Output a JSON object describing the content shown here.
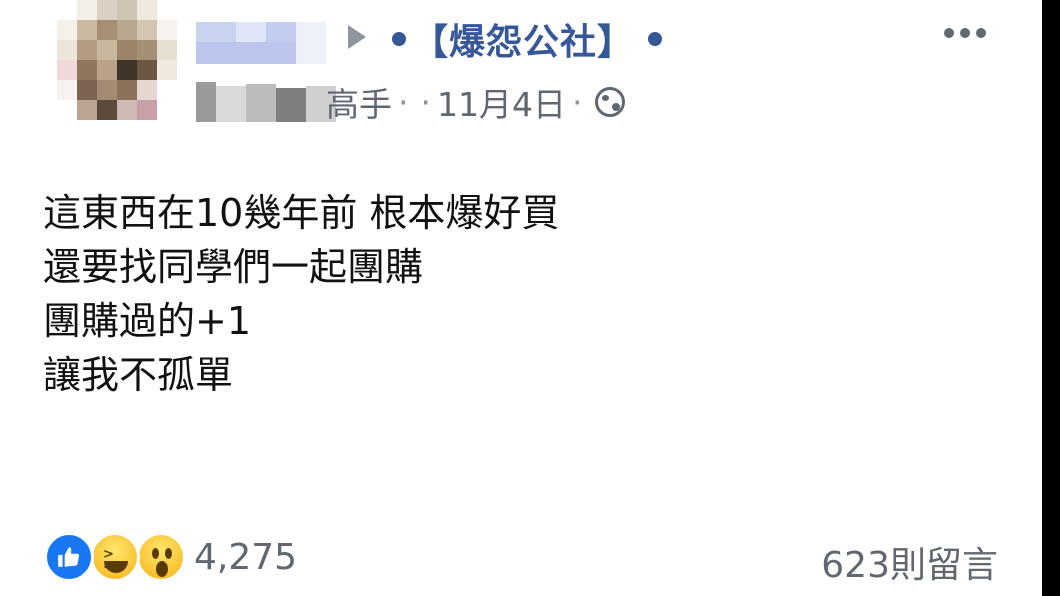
{
  "post": {
    "group_name": "【爆怨公社】",
    "author_title_fragment": "高手",
    "separator": "·",
    "date": "11月4日",
    "body_lines": [
      "這東西在10幾年前 根本爆好買",
      "還要找同學們一起團購",
      "團購過的+1",
      "讓我不孤單"
    ]
  },
  "reactions": {
    "count": "4,275",
    "icons": [
      "like-icon",
      "haha-icon",
      "wow-icon"
    ]
  },
  "comments": {
    "label": "623則留言"
  },
  "colors": {
    "link": "#365899",
    "meta": "#606770",
    "like": "#1877f2"
  }
}
